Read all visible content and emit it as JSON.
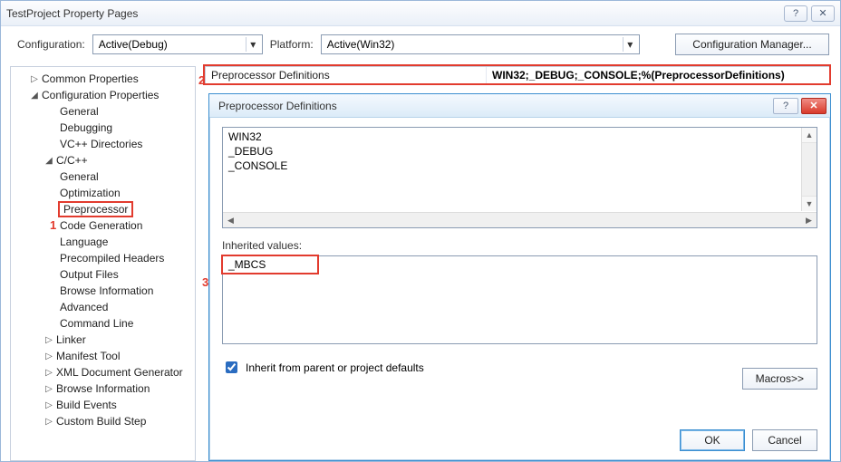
{
  "window": {
    "title": "TestProject Property Pages"
  },
  "toolbar": {
    "configuration_label": "Configuration:",
    "configuration_value": "Active(Debug)",
    "platform_label": "Platform:",
    "platform_value": "Active(Win32)",
    "config_manager_label": "Configuration Manager..."
  },
  "tree": {
    "common_properties": "Common Properties",
    "configuration_properties": "Configuration Properties",
    "general": "General",
    "debugging": "Debugging",
    "vcpp_directories": "VC++ Directories",
    "ccpp": "C/C++",
    "ccpp_general": "General",
    "optimization": "Optimization",
    "preprocessor": "Preprocessor",
    "code_generation": "Code Generation",
    "language": "Language",
    "precompiled_headers": "Precompiled Headers",
    "output_files": "Output Files",
    "browse_information": "Browse Information",
    "advanced": "Advanced",
    "command_line": "Command Line",
    "linker": "Linker",
    "manifest_tool": "Manifest Tool",
    "xml_doc_gen": "XML Document Generator",
    "browse_information2": "Browse Information",
    "build_events": "Build Events",
    "custom_build_step": "Custom Build Step"
  },
  "proprow": {
    "key": "Preprocessor Definitions",
    "value": "WIN32;_DEBUG;_CONSOLE;%(PreprocessorDefinitions)"
  },
  "dialog": {
    "title": "Preprocessor Definitions",
    "definitions_text": "WIN32\n_DEBUG\n_CONSOLE",
    "inherited_label": "Inherited values:",
    "inherited_values": "_MBCS",
    "inherit_checkbox_label": "Inherit from parent or project defaults",
    "inherit_checked": true,
    "macros_label": "Macros>>",
    "ok_label": "OK",
    "cancel_label": "Cancel"
  },
  "annotations": {
    "a1": "1",
    "a2": "2",
    "a3": "3"
  }
}
